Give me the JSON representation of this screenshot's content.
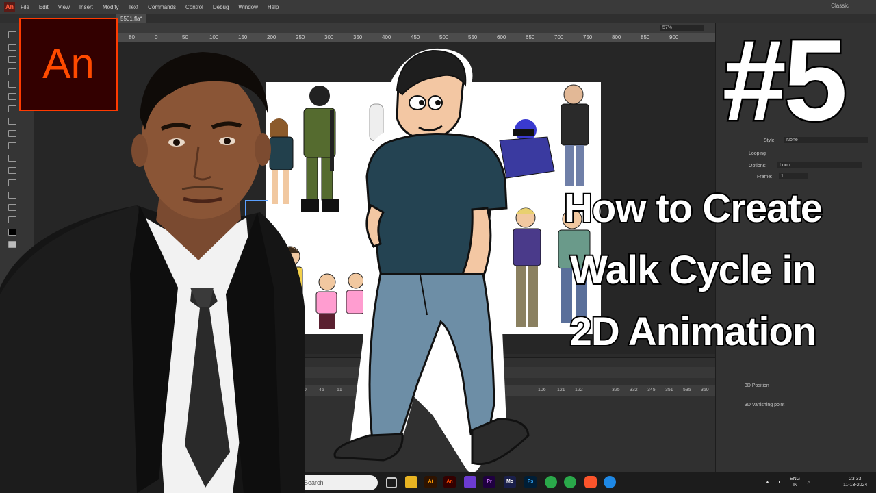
{
  "menubar": {
    "app_icon": "An",
    "items": [
      "File",
      "Edit",
      "View",
      "Insert",
      "Modify",
      "Text",
      "Commands",
      "Control",
      "Debug",
      "Window",
      "Help"
    ],
    "workspace": "Classic"
  },
  "document_tab": "5501.fla*",
  "zoom": "57%",
  "ruler_marks": [
    "80",
    "0",
    "50",
    "100",
    "150",
    "200",
    "250",
    "300",
    "350",
    "400",
    "450",
    "500",
    "550",
    "600",
    "650",
    "700",
    "750",
    "800",
    "850",
    "900"
  ],
  "frame_numbers": [
    "40",
    "45",
    "51",
    "",
    "106",
    "121",
    "122",
    "",
    "325",
    "332",
    "345",
    "351",
    "535",
    "350"
  ],
  "properties": {
    "style_label": "Style:",
    "style_value": "None",
    "section_looping": "Looping",
    "options_label": "Options:",
    "options_value": "Loop",
    "frame_label": "Frame:",
    "frame_value": "1",
    "position_label": "3D Position",
    "vanishing_label": "3D Vanishing point"
  },
  "taskbar": {
    "search_placeholder": "Search",
    "apps": [
      {
        "label": "Ai",
        "bg": "#2e1300",
        "fg": "#ff9a00",
        "icon": "illustrator-icon"
      },
      {
        "label": "An",
        "bg": "#330000",
        "fg": "#ff4a00",
        "icon": "animate-icon"
      },
      {
        "label": "Pr",
        "bg": "#1f0040",
        "fg": "#d07bff",
        "icon": "premiere-icon"
      },
      {
        "label": "Mo",
        "bg": "#1a1f4a",
        "fg": "#ffffff",
        "icon": "notes-icon"
      },
      {
        "label": "Ps",
        "bg": "#001e36",
        "fg": "#31a8ff",
        "icon": "photoshop-icon"
      }
    ],
    "lang": "ENG",
    "lang_region": "IN",
    "time": "23:33",
    "date": "11-13-2024"
  },
  "logo_text": "An",
  "title": {
    "number": "#5",
    "line1": "How to Create",
    "line2": "Walk Cycle in",
    "line3": "2D Animation"
  },
  "colors": {
    "animate_brand": "#ff3a00",
    "animate_bg": "#330000",
    "ui_dark": "#2b2b2b"
  }
}
